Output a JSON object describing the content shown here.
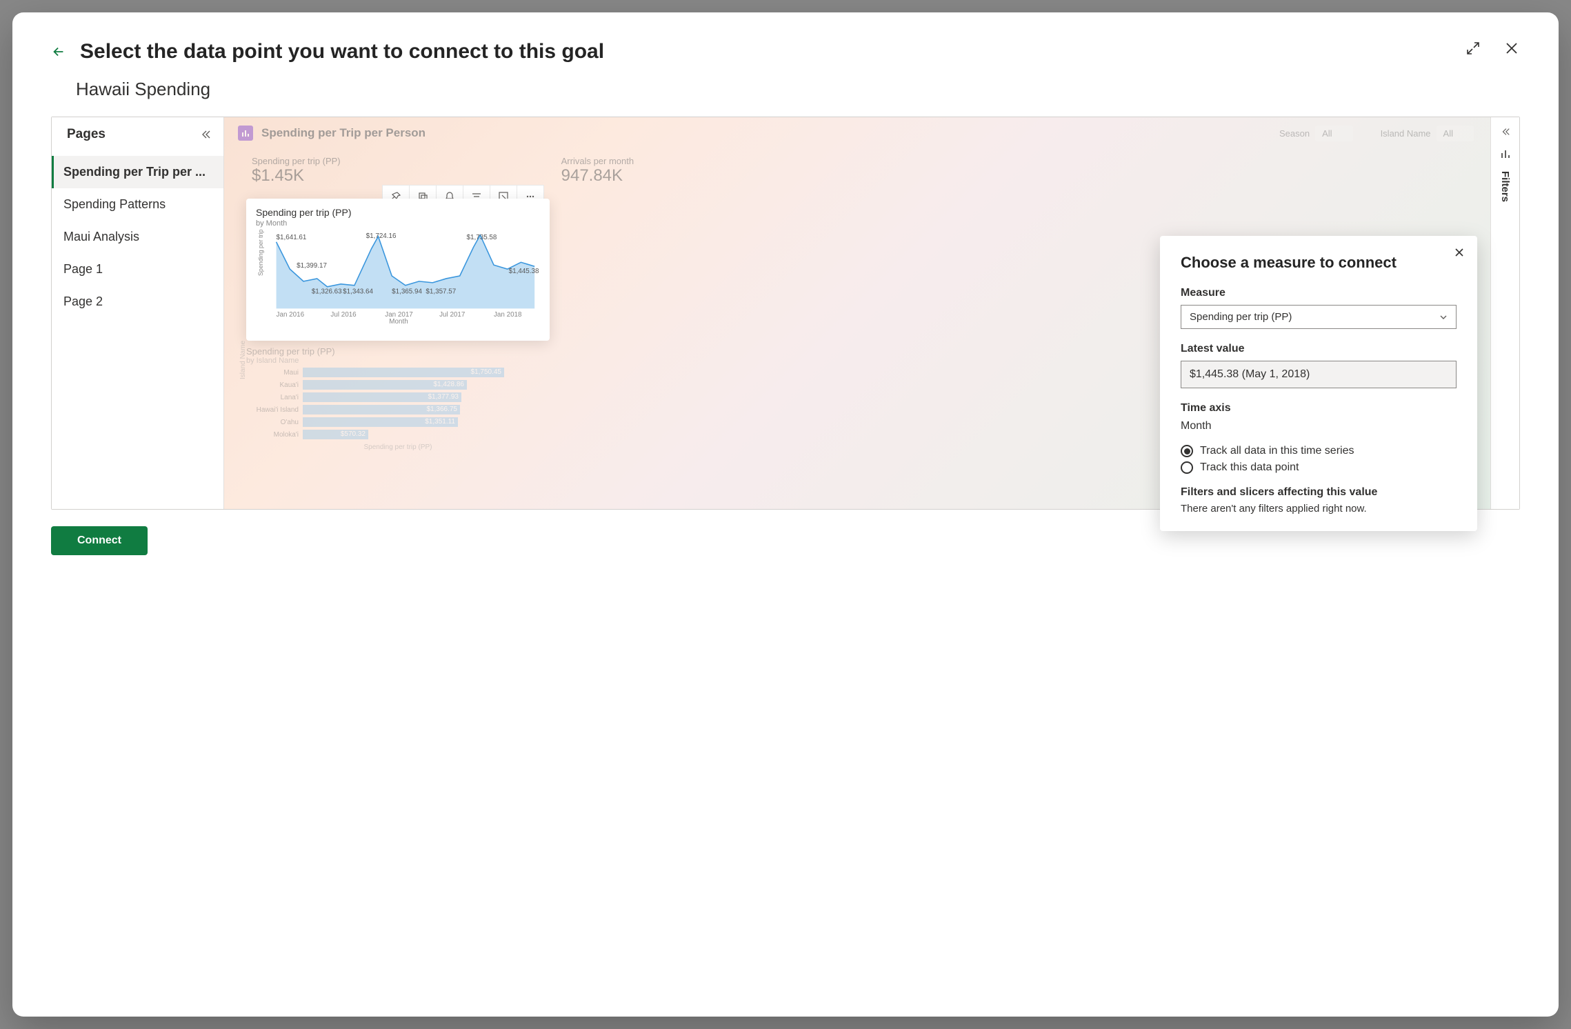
{
  "dialog": {
    "title": "Select the data point you want to connect to this goal",
    "report_name": "Hawaii Spending",
    "connect_button": "Connect"
  },
  "pages": {
    "header": "Pages",
    "items": [
      {
        "label": "Spending per Trip per ...",
        "active": true
      },
      {
        "label": "Spending Patterns",
        "active": false
      },
      {
        "label": "Maui Analysis",
        "active": false
      },
      {
        "label": "Page 1",
        "active": false
      },
      {
        "label": "Page 2",
        "active": false
      }
    ]
  },
  "canvas": {
    "title": "Spending per Trip per Person",
    "slicers": [
      {
        "name": "Season",
        "value": "All"
      },
      {
        "name": "Island Name",
        "value": "All"
      }
    ],
    "kpi1": {
      "label": "Spending per trip (PP)",
      "value": "$1.45K"
    },
    "kpi2": {
      "label": "Arrivals per month",
      "value": "947.84K"
    }
  },
  "chart_data": {
    "type": "line",
    "title": "Spending per trip (PP)",
    "subtitle": "by Month",
    "ylabel": "Spending per trip (PP)",
    "xlabel": "Month",
    "x_ticks": [
      "Jan 2016",
      "Jul 2016",
      "Jan 2017",
      "Jul 2017",
      "Jan 2018"
    ],
    "data_labels": [
      {
        "x": "Jan 2016",
        "value": 1641.61
      },
      {
        "x": "Apr 2016",
        "value": 1399.17
      },
      {
        "x": "Jun 2016",
        "value": 1326.63
      },
      {
        "x": "Jul 2016",
        "value": 1343.64
      },
      {
        "x": "Dec 2016",
        "value": 1724.16
      },
      {
        "x": "Mar 2017",
        "value": 1365.94
      },
      {
        "x": "May 2017",
        "value": 1357.57
      },
      {
        "x": "Dec 2017",
        "value": 1735.58
      },
      {
        "x": "May 2018",
        "value": 1445.38
      }
    ],
    "ylim": [
      1300,
      1800
    ]
  },
  "bar_chart_data": {
    "type": "bar",
    "title": "Spending per trip (PP)",
    "subtitle": "by Island Name",
    "xlabel": "Spending per trip (PP)",
    "ylabel": "Island Name",
    "categories": [
      "Maui",
      "Kaua'i",
      "Lana'i",
      "Hawai'i Island",
      "O'ahu",
      "Moloka'i"
    ],
    "values": [
      1750.45,
      1428.86,
      1377.93,
      1366.75,
      1351.11,
      570.32
    ],
    "xlim": [
      0,
      1800
    ]
  },
  "measure_panel": {
    "title": "Choose a measure to connect",
    "measure_label": "Measure",
    "measure_value": "Spending per trip (PP)",
    "latest_label": "Latest value",
    "latest_value": "$1,445.38 (May 1, 2018)",
    "time_axis_label": "Time axis",
    "time_axis_value": "Month",
    "radio1": "Track all data in this time series",
    "radio2": "Track this data point",
    "filters_header": "Filters and slicers affecting this value",
    "filters_note": "There aren't any filters applied right now."
  },
  "filters_rail": {
    "label": "Filters"
  }
}
